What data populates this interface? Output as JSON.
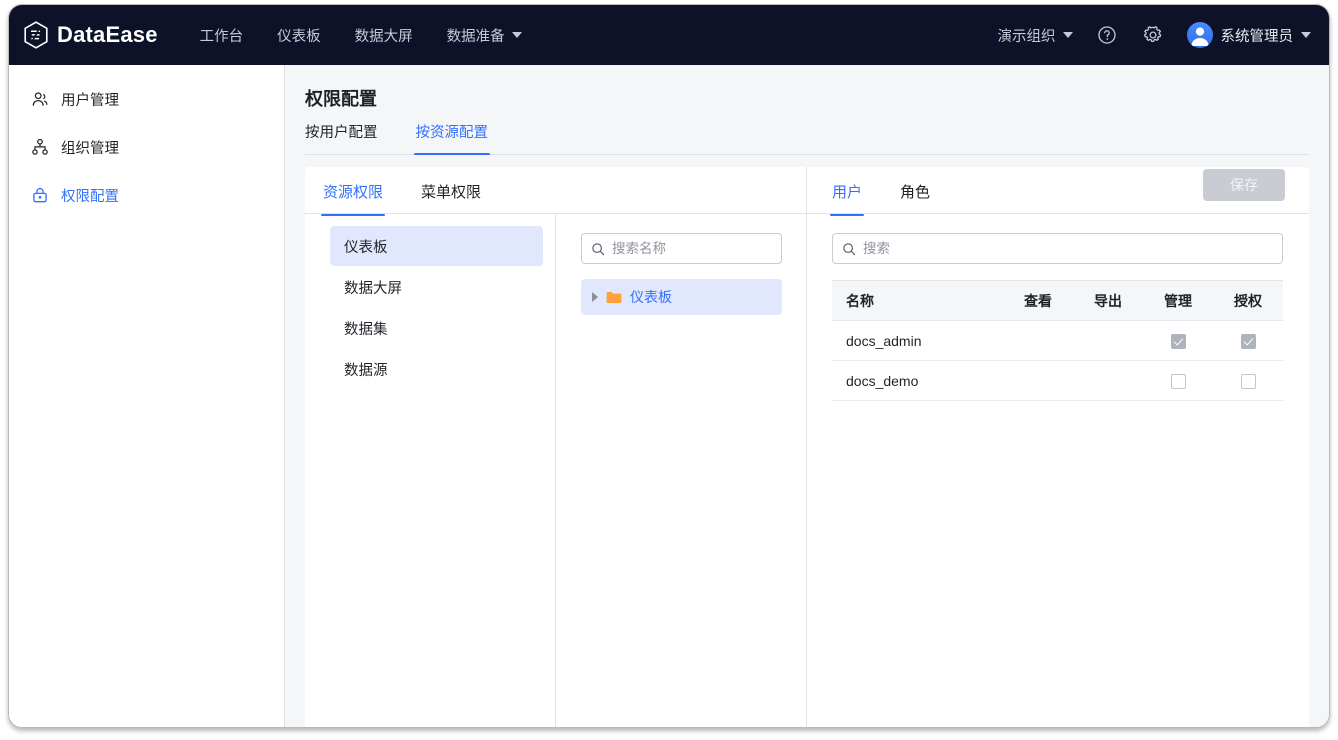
{
  "app": {
    "brand": "DataEase",
    "brand_icon": "dataease-hexagon-logo"
  },
  "topnav": {
    "links": [
      {
        "label": "工作台",
        "has_caret": false
      },
      {
        "label": "仪表板",
        "has_caret": false
      },
      {
        "label": "数据大屏",
        "has_caret": false
      },
      {
        "label": "数据准备",
        "has_caret": true
      }
    ],
    "org_selector": {
      "label": "演示组织",
      "icon": "chevron-down-icon"
    },
    "help_icon": "question-circle-icon",
    "settings_icon": "gear-icon",
    "user": {
      "name": "系统管理员",
      "avatar_icon": "user-avatar-icon",
      "caret_icon": "chevron-down-icon"
    }
  },
  "sidebar": {
    "items": [
      {
        "label": "用户管理",
        "icon": "users-icon",
        "active": false
      },
      {
        "label": "组织管理",
        "icon": "org-tree-icon",
        "active": false
      },
      {
        "label": "权限配置",
        "icon": "lock-icon",
        "active": true
      }
    ]
  },
  "main": {
    "page_title": "权限配置",
    "tabs": [
      {
        "label": "按用户配置",
        "active": false
      },
      {
        "label": "按资源配置",
        "active": true
      }
    ]
  },
  "resource_panel": {
    "tabs": [
      {
        "label": "资源权限",
        "active": true
      },
      {
        "label": "菜单权限",
        "active": false
      }
    ],
    "type_list": [
      {
        "label": "仪表板",
        "selected": true
      },
      {
        "label": "数据大屏",
        "selected": false
      },
      {
        "label": "数据集",
        "selected": false
      },
      {
        "label": "数据源",
        "selected": false
      }
    ],
    "search": {
      "placeholder": "搜索名称",
      "value": "",
      "icon": "search-icon"
    },
    "tree": [
      {
        "label": "仪表板",
        "icon": "folder-icon",
        "arrow_icon": "triangle-right-icon",
        "expanded": false,
        "selected": true
      }
    ]
  },
  "permission_panel": {
    "tabs": [
      {
        "label": "用户",
        "active": true
      },
      {
        "label": "角色",
        "active": false
      }
    ],
    "save_label": "保存",
    "save_disabled": true,
    "search": {
      "placeholder": "搜索",
      "value": "",
      "icon": "search-icon"
    },
    "table": {
      "columns": [
        "名称",
        "查看",
        "导出",
        "管理",
        "授权"
      ],
      "rows": [
        {
          "name": "docs_admin",
          "查看": null,
          "导出": null,
          "管理": "checked-disabled",
          "授权": "checked-disabled"
        },
        {
          "name": "docs_demo",
          "查看": null,
          "导出": null,
          "管理": "unchecked",
          "授权": "unchecked"
        }
      ]
    }
  },
  "colors": {
    "nav_bg": "#0d1228",
    "accent": "#3370ff",
    "selected_bg": "#e1e7fc",
    "folder": "#ffa239",
    "page_bg": "#f5f6f7"
  }
}
